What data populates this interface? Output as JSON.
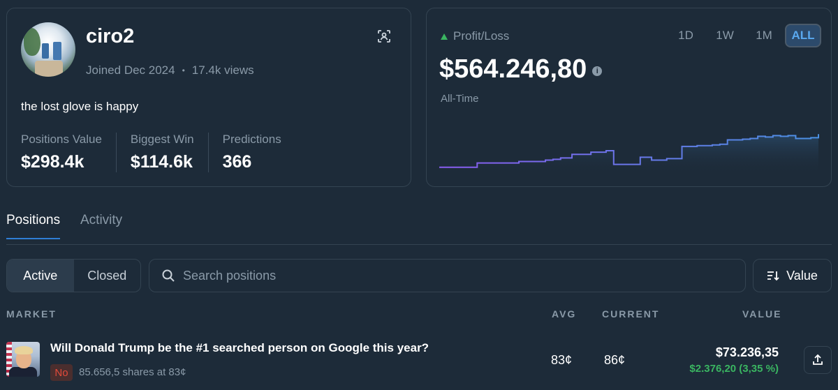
{
  "profile": {
    "username": "ciro2",
    "joined": "Joined Dec 2024",
    "views": "17.4k views",
    "bio": "the lost glove is happy",
    "stats": [
      {
        "label": "Positions Value",
        "value": "$298.4k"
      },
      {
        "label": "Biggest Win",
        "value": "$114.6k"
      },
      {
        "label": "Predictions",
        "value": "366"
      }
    ]
  },
  "pnl": {
    "label": "Profit/Loss",
    "value": "$564.246,80",
    "period": "All-Time",
    "ranges": [
      "1D",
      "1W",
      "1M",
      "ALL"
    ],
    "active_range": "ALL",
    "colors": {
      "up": "#3ab561",
      "line_start": "#8a5cf0",
      "line_end": "#4a90e2"
    }
  },
  "chart_data": {
    "type": "line",
    "x": [
      0,
      9,
      10,
      20,
      21,
      22,
      28,
      30,
      32,
      35,
      40,
      44,
      45,
      46,
      47,
      50,
      53,
      55,
      56,
      58,
      60,
      62,
      64,
      66,
      68,
      70,
      72,
      74,
      75,
      76,
      77,
      80,
      82,
      84,
      85,
      86,
      88,
      90,
      92,
      94,
      96,
      98,
      100
    ],
    "values": [
      6,
      6,
      12,
      12,
      14,
      14,
      16,
      17,
      19,
      24,
      27,
      29,
      29,
      10,
      10,
      10,
      20,
      20,
      16,
      16,
      18,
      18,
      35,
      35,
      36,
      36,
      37,
      38,
      38,
      44,
      44,
      45,
      46,
      49,
      49,
      48,
      50,
      49,
      50,
      46,
      46,
      47,
      52
    ],
    "title": "",
    "xlabel": "",
    "ylabel": "",
    "ylim": [
      0,
      60
    ]
  },
  "tabs": [
    {
      "label": "Positions",
      "active": true
    },
    {
      "label": "Activity",
      "active": false
    }
  ],
  "filters": {
    "active_label": "Active",
    "closed_label": "Closed",
    "search_placeholder": "Search positions",
    "sort_label": "Value"
  },
  "table": {
    "headers": {
      "market": "MARKET",
      "avg": "AVG",
      "current": "CURRENT",
      "value": "VALUE"
    },
    "rows": [
      {
        "title": "Will Donald Trump be the #1 searched person on Google this year?",
        "outcome": "No",
        "shares": "85.656,5 shares at 83¢",
        "avg": "83¢",
        "current": "86¢",
        "value": "$73.236,35",
        "change": "$2.376,20 (3,35 %)"
      }
    ]
  }
}
